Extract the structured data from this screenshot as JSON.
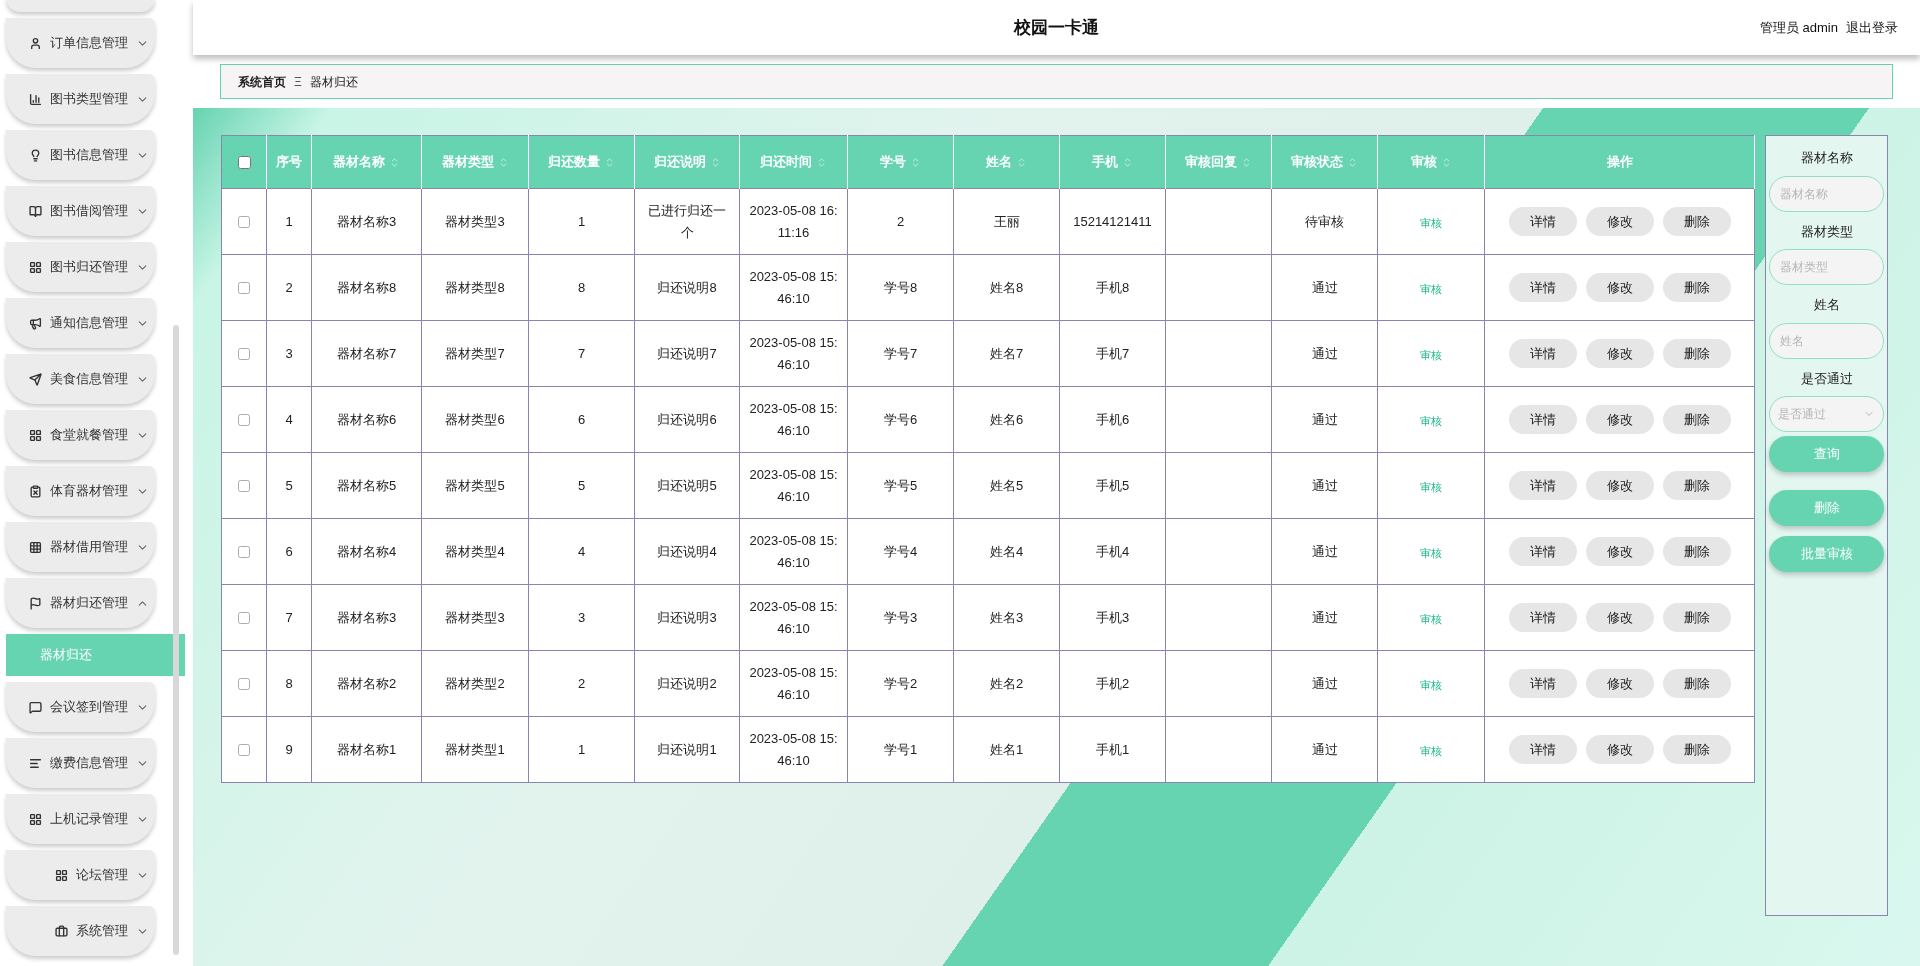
{
  "header": {
    "title": "校园一卡通",
    "user_role": "管理员",
    "user_name": "admin",
    "logout": "退出登录"
  },
  "breadcrumb": {
    "home": "系统首页",
    "separator": "Ξ",
    "current": "器材归还"
  },
  "sidebar": {
    "items": [
      {
        "label": "订单信息管理",
        "expanded": false
      },
      {
        "label": "图书类型管理",
        "expanded": false
      },
      {
        "label": "图书信息管理",
        "expanded": false
      },
      {
        "label": "图书借阅管理",
        "expanded": false
      },
      {
        "label": "图书归还管理",
        "expanded": false
      },
      {
        "label": "通知信息管理",
        "expanded": false
      },
      {
        "label": "美食信息管理",
        "expanded": false
      },
      {
        "label": "食堂就餐管理",
        "expanded": false
      },
      {
        "label": "体育器材管理",
        "expanded": false
      },
      {
        "label": "器材借用管理",
        "expanded": false
      },
      {
        "label": "器材归还管理",
        "expanded": true,
        "children": [
          {
            "label": "器材归还",
            "selected": true
          }
        ]
      },
      {
        "label": "会议签到管理",
        "expanded": false
      },
      {
        "label": "缴费信息管理",
        "expanded": false
      },
      {
        "label": "上机记录管理",
        "expanded": false
      },
      {
        "label": "论坛管理",
        "expanded": false
      },
      {
        "label": "系统管理",
        "expanded": false
      }
    ]
  },
  "table": {
    "select_all": false,
    "columns": [
      {
        "label": "序号",
        "sortable": false
      },
      {
        "label": "器材名称",
        "sortable": true
      },
      {
        "label": "器材类型",
        "sortable": true
      },
      {
        "label": "归还数量",
        "sortable": true
      },
      {
        "label": "归还说明",
        "sortable": true
      },
      {
        "label": "归还时间",
        "sortable": true
      },
      {
        "label": "学号",
        "sortable": true
      },
      {
        "label": "姓名",
        "sortable": true
      },
      {
        "label": "手机",
        "sortable": true
      },
      {
        "label": "审核回复",
        "sortable": true
      },
      {
        "label": "审核状态",
        "sortable": true
      },
      {
        "label": "审核",
        "sortable": true
      },
      {
        "label": "操作",
        "sortable": false
      }
    ],
    "rows": [
      {
        "checked": false,
        "cells": [
          "1",
          "器材名称3",
          "器材类型3",
          "1",
          "已进行归还一个",
          "2023-05-08 16:11:16",
          "2",
          "王丽",
          "15214121411",
          "",
          "待审核"
        ],
        "review_link": "审核",
        "actions": [
          "详情",
          "修改",
          "删除"
        ]
      },
      {
        "checked": false,
        "cells": [
          "2",
          "器材名称8",
          "器材类型8",
          "8",
          "归还说明8",
          "2023-05-08 15:46:10",
          "学号8",
          "姓名8",
          "手机8",
          "",
          "通过"
        ],
        "review_link": "审核",
        "actions": [
          "详情",
          "修改",
          "删除"
        ]
      },
      {
        "checked": false,
        "cells": [
          "3",
          "器材名称7",
          "器材类型7",
          "7",
          "归还说明7",
          "2023-05-08 15:46:10",
          "学号7",
          "姓名7",
          "手机7",
          "",
          "通过"
        ],
        "review_link": "审核",
        "actions": [
          "详情",
          "修改",
          "删除"
        ]
      },
      {
        "checked": false,
        "cells": [
          "4",
          "器材名称6",
          "器材类型6",
          "6",
          "归还说明6",
          "2023-05-08 15:46:10",
          "学号6",
          "姓名6",
          "手机6",
          "",
          "通过"
        ],
        "review_link": "审核",
        "actions": [
          "详情",
          "修改",
          "删除"
        ]
      },
      {
        "checked": false,
        "cells": [
          "5",
          "器材名称5",
          "器材类型5",
          "5",
          "归还说明5",
          "2023-05-08 15:46:10",
          "学号5",
          "姓名5",
          "手机5",
          "",
          "通过"
        ],
        "review_link": "审核",
        "actions": [
          "详情",
          "修改",
          "删除"
        ]
      },
      {
        "checked": false,
        "cells": [
          "6",
          "器材名称4",
          "器材类型4",
          "4",
          "归还说明4",
          "2023-05-08 15:46:10",
          "学号4",
          "姓名4",
          "手机4",
          "",
          "通过"
        ],
        "review_link": "审核",
        "actions": [
          "详情",
          "修改",
          "删除"
        ]
      },
      {
        "checked": false,
        "cells": [
          "7",
          "器材名称3",
          "器材类型3",
          "3",
          "归还说明3",
          "2023-05-08 15:46:10",
          "学号3",
          "姓名3",
          "手机3",
          "",
          "通过"
        ],
        "review_link": "审核",
        "actions": [
          "详情",
          "修改",
          "删除"
        ]
      },
      {
        "checked": false,
        "cells": [
          "8",
          "器材名称2",
          "器材类型2",
          "2",
          "归还说明2",
          "2023-05-08 15:46:10",
          "学号2",
          "姓名2",
          "手机2",
          "",
          "通过"
        ],
        "review_link": "审核",
        "actions": [
          "详情",
          "修改",
          "删除"
        ]
      },
      {
        "checked": false,
        "cells": [
          "9",
          "器材名称1",
          "器材类型1",
          "1",
          "归还说明1",
          "2023-05-08 15:46:10",
          "学号1",
          "姓名1",
          "手机1",
          "",
          "通过"
        ],
        "review_link": "审核",
        "actions": [
          "详情",
          "修改",
          "删除"
        ]
      }
    ]
  },
  "filters": {
    "fields": [
      {
        "kind": "text",
        "label": "器材名称",
        "placeholder": "器材名称"
      },
      {
        "kind": "text",
        "label": "器材类型",
        "placeholder": "器材类型"
      },
      {
        "kind": "text",
        "label": "姓名",
        "placeholder": "姓名"
      },
      {
        "kind": "select",
        "label": "是否通过",
        "placeholder": "是否通过"
      }
    ],
    "buttons": [
      "查询",
      "删除",
      "批量审核"
    ]
  }
}
